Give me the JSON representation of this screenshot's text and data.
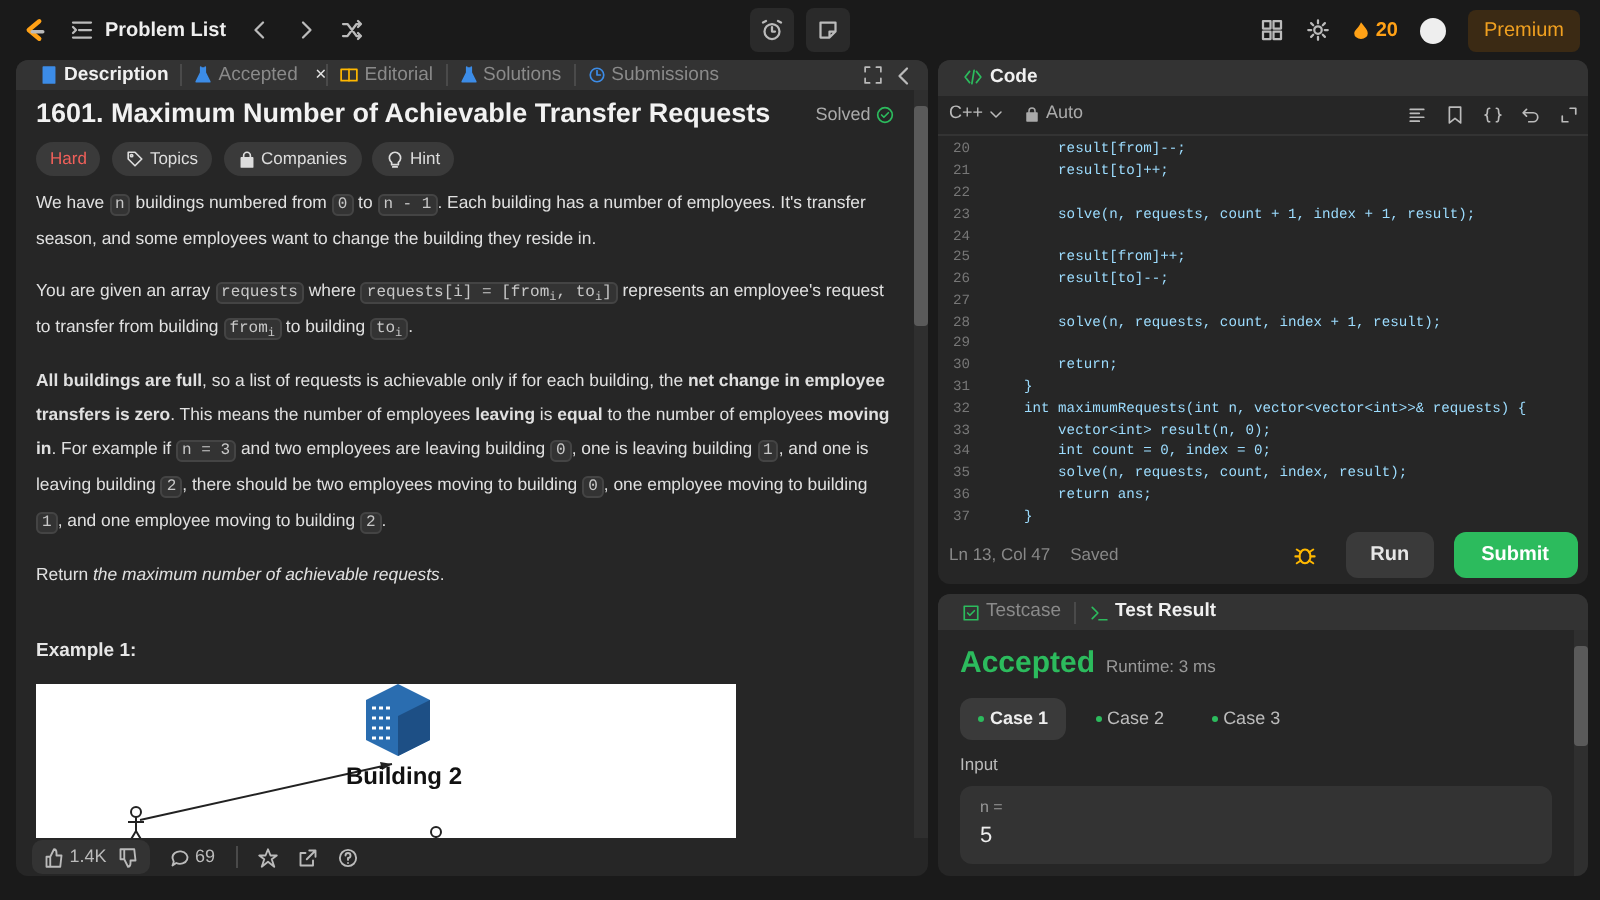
{
  "top_bar": {
    "nav_label": "Problem List",
    "streak": "20",
    "premium": "Premium"
  },
  "description_panel": {
    "tabs": [
      {
        "label": "Description",
        "selected": true,
        "kind": "doc"
      },
      {
        "label": "Accepted",
        "selected": false,
        "kind": "flask",
        "close": "×"
      },
      {
        "label": "Editorial",
        "selected": false,
        "kind": "book"
      },
      {
        "label": "Solutions",
        "selected": false,
        "kind": "flask"
      },
      {
        "label": "Submissions",
        "selected": false,
        "kind": "clock"
      }
    ],
    "title": "1601. Maximum Number of Achievable Transfer Requests",
    "status": "Solved",
    "difficulty": "Hard",
    "tags": [
      {
        "label": "Topics",
        "kind": "tag"
      },
      {
        "label": "Companies",
        "kind": "lock"
      },
      {
        "label": "Hint",
        "kind": "bulb"
      }
    ],
    "paragraphs": [
      [
        {
          "kind": "text",
          "text": "We have "
        },
        {
          "kind": "code",
          "text": "n"
        },
        {
          "kind": "text",
          "text": " buildings numbered from "
        },
        {
          "kind": "code",
          "text": "0"
        },
        {
          "kind": "text",
          "text": " to "
        },
        {
          "kind": "code",
          "text": "n - 1"
        },
        {
          "kind": "text",
          "text": ". Each building has a number of employees. It's transfer season, and some employees want to change the building they reside in."
        }
      ],
      [
        {
          "kind": "text",
          "text": "You are given an array "
        },
        {
          "kind": "code",
          "text": "requests"
        },
        {
          "kind": "text",
          "text": " where "
        },
        {
          "kind": "code",
          "text": "requests[i] = [from$_{i}$, to$_{i}$]"
        },
        {
          "kind": "text",
          "text": " represents an employee's request to transfer from building "
        },
        {
          "kind": "code",
          "text": "from$_{i}$"
        },
        {
          "kind": "text",
          "text": " to building "
        },
        {
          "kind": "code",
          "text": "to$_{i}$"
        },
        {
          "kind": "text",
          "text": "."
        }
      ],
      [
        {
          "kind": "text",
          "text": "**All buildings are full**, so a list of requests is achievable only if for each building, the **net change in employee transfers is zero**. This means the number of employees **leaving** is **equal** to the number of employees **moving in**. For example if "
        },
        {
          "kind": "code",
          "text": "n = 3"
        },
        {
          "kind": "text",
          "text": " and two employees are leaving building "
        },
        {
          "kind": "code",
          "text": "0"
        },
        {
          "kind": "text",
          "text": ", one is leaving building "
        },
        {
          "kind": "code",
          "text": "1"
        },
        {
          "kind": "text",
          "text": ", and one is leaving building "
        },
        {
          "kind": "code",
          "text": "2"
        },
        {
          "kind": "text",
          "text": ", there should be two employees moving to building "
        },
        {
          "kind": "code",
          "text": "0"
        },
        {
          "kind": "text",
          "text": ", one employee moving to building "
        },
        {
          "kind": "code",
          "text": "1"
        },
        {
          "kind": "text",
          "text": ", and one employee moving to building "
        },
        {
          "kind": "code",
          "text": "2"
        },
        {
          "kind": "text",
          "text": "."
        }
      ],
      [
        {
          "kind": "text",
          "text": "Return *the maximum number of achievable requests*."
        }
      ]
    ],
    "example_heading": "Example 1:",
    "figure_label": "Building 2",
    "footer": {
      "likes": "1.4K",
      "comments": "69"
    }
  },
  "code_panel": {
    "title": "Code",
    "language": "C++",
    "mode": "Auto",
    "lines": [
      {
        "number": "20",
        "text": "        result[from]--;"
      },
      {
        "number": "21",
        "text": "        result[to]++;"
      },
      {
        "number": "22"
      },
      {
        "number": "23",
        "text": "        solve(n, requests, count + 1, index + 1, result);"
      },
      {
        "number": "24"
      },
      {
        "number": "25",
        "text": "        result[from]++;"
      },
      {
        "number": "26",
        "text": "        result[to]--;"
      },
      {
        "number": "27"
      },
      {
        "number": "28",
        "text": "        solve(n, requests, count, index + 1, result);"
      },
      {
        "number": "29"
      },
      {
        "number": "30",
        "text": "        return;"
      },
      {
        "number": "31",
        "text": "    }"
      },
      {
        "number": "32",
        "text": "    int maximumRequests(int n, vector<vector<int>>& requests) {"
      },
      {
        "number": "33",
        "text": "        vector<int> result(n, 0);"
      },
      {
        "number": "34",
        "text": "        int count = 0, index = 0;"
      },
      {
        "number": "35",
        "text": "        solve(n, requests, count, index, result);"
      },
      {
        "number": "36",
        "text": "        return ans;"
      },
      {
        "number": "37",
        "text": "    }"
      }
    ],
    "cursor": "Ln 13, Col 47",
    "save_state": "Saved",
    "buttons": [
      {
        "label": "Run",
        "kind": "secondary"
      },
      {
        "label": "Submit",
        "kind": "primary"
      }
    ]
  },
  "test_panel": {
    "tabs": [
      {
        "label": "Testcase",
        "selected": false,
        "kind": "check"
      },
      {
        "label": "Test Result",
        "selected": true,
        "kind": "terminal"
      }
    ],
    "verdict": "Accepted",
    "runtime": "Runtime: 3 ms",
    "cases": [
      {
        "label": "Case 1",
        "selected": true
      },
      {
        "label": "Case 2",
        "selected": false
      },
      {
        "label": "Case 3",
        "selected": false
      }
    ],
    "input_label": "Input",
    "inputs": [
      {
        "name": "n =",
        "value": "5"
      }
    ]
  }
}
